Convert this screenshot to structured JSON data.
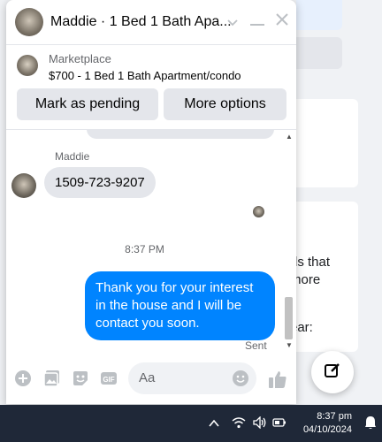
{
  "background": {
    "snippet1": "ds that",
    "snippet2": "more",
    "snippet3": "ear:"
  },
  "chat": {
    "header_title": "Maddie · 1 Bed 1 Bath Apa...",
    "marketplace_label": "Marketplace",
    "listing": "$700 - 1 Bed 1 Bath Apartment/condo",
    "buttons": {
      "pending": "Mark as pending",
      "more": "More options"
    },
    "sender_name": "Maddie",
    "incoming_message": "1509-723-9207",
    "timestamp": "8:37 PM",
    "outgoing_message": "Thank you for your interest in the house and I will be contact you soon.",
    "sent_status": "Sent",
    "composer_placeholder": "Aa",
    "accent_color": "#0084ff"
  },
  "taskbar": {
    "time": "8:37 pm",
    "date": "04/10/2024"
  }
}
